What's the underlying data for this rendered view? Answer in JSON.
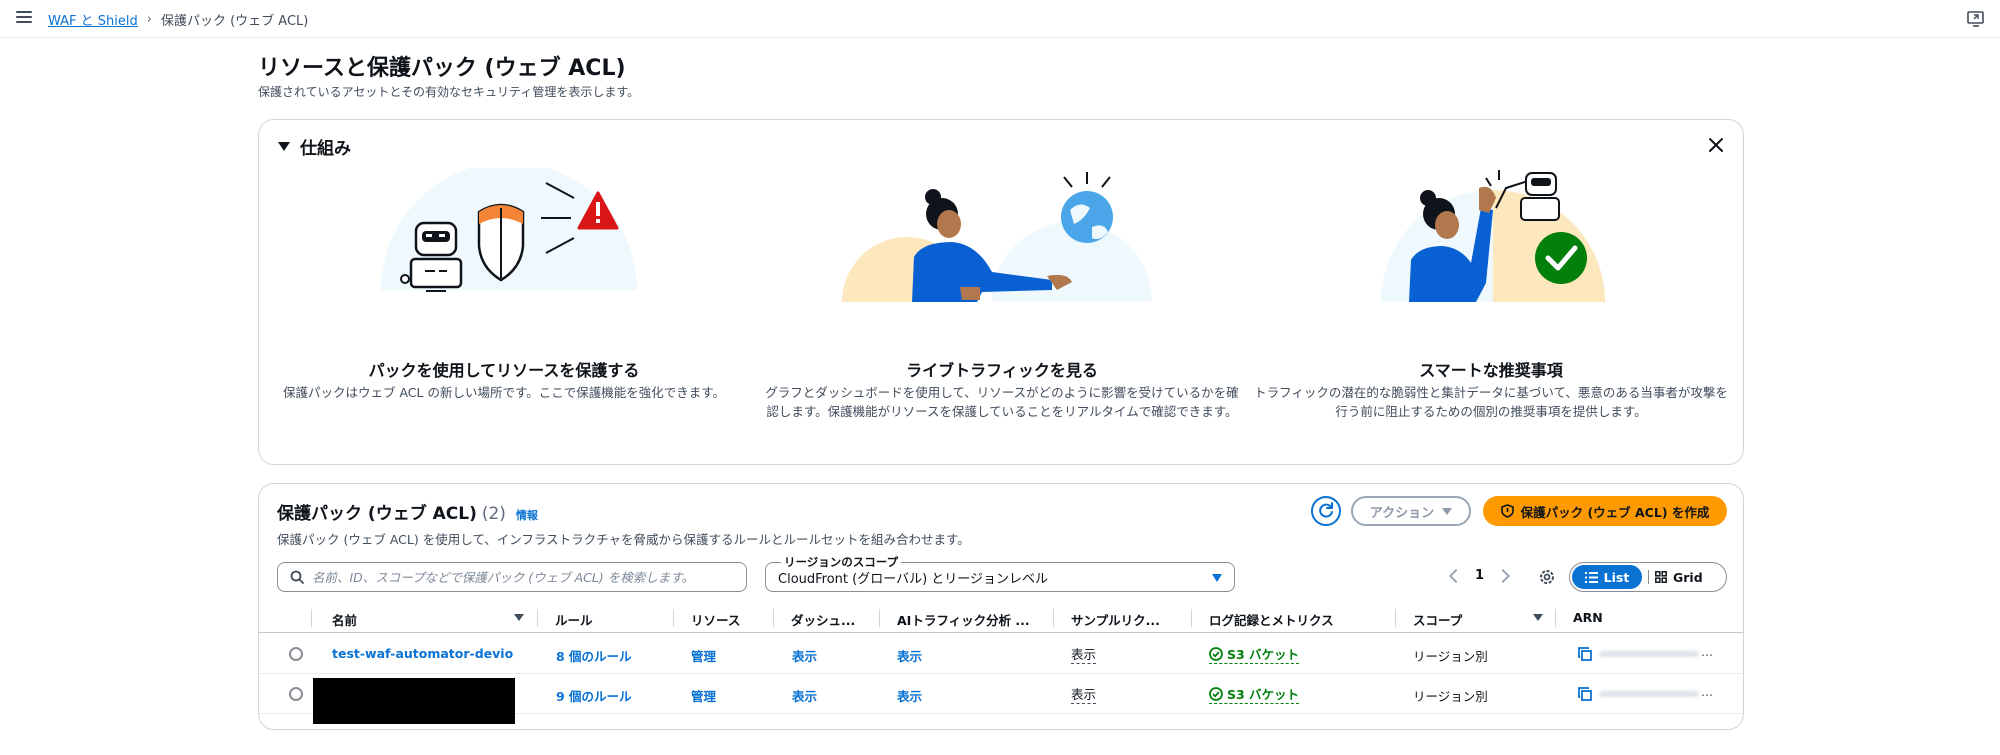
{
  "breadcrumb": {
    "parent": "WAF と Shield",
    "current": "保護パック (ウェブ ACL)"
  },
  "page": {
    "title": "リソースと保護パック (ウェブ ACL)",
    "description": "保護されているアセットとその有効なセキュリティ管理を表示します。"
  },
  "how_it_works": {
    "title": "仕組み",
    "columns": [
      {
        "title": "パックを使用してリソースを保護する",
        "description": "保護パックはウェブ ACL の新しい場所です。ここで保護機能を強化できます。"
      },
      {
        "title": "ライブトラフィックを見る",
        "description": "グラフとダッシュボードを使用して、リソースがどのように影響を受けているかを確認します。保護機能がリソースを保護していることをリアルタイムで確認できます。"
      },
      {
        "title": "スマートな推奨事項",
        "description": "トラフィックの潜在的な脆弱性と集計データに基づいて、悪意のある当事者が攻撃を行う前に阻止するための個別の推奨事項を提供します。"
      }
    ]
  },
  "packs": {
    "title": "保護パック (ウェブ ACL)",
    "count": "(2)",
    "info": "情報",
    "description": "保護パック (ウェブ ACL) を使用して、インフラストラクチャを脅威から保護するルールとルールセットを組み合わせます。",
    "actions_label": "アクション",
    "create_label": "保護パック (ウェブ ACL) を作成",
    "search_placeholder": "名前、ID、スコープなどで保護パック (ウェブ ACL) を検索します。",
    "scope_label": "リージョンのスコープ",
    "scope_value": "CloudFront (グローバル) とリージョンレベル",
    "page_number": "1",
    "view_list": "List",
    "view_grid": "Grid",
    "columns": [
      "名前",
      "ルール",
      "リソース",
      "ダッシュ...",
      "AIトラフィック分析 ...",
      "サンプルリク...",
      "ログ記録とメトリクス",
      "スコープ",
      "ARN"
    ],
    "rows": [
      {
        "name": "test-waf-automator-devio",
        "rules": "8 個のルール",
        "resources": "管理",
        "dashboard": "表示",
        "ai": "表示",
        "sample": "表示",
        "logging": "S3 バケット",
        "scope": "リージョン別",
        "arn_more": "..."
      },
      {
        "name": "",
        "rules": "9 個のルール",
        "resources": "管理",
        "dashboard": "表示",
        "ai": "表示",
        "sample": "表示",
        "logging": "S3 バケット",
        "scope": "リージョン別",
        "arn_more": "..."
      }
    ]
  },
  "colors": {
    "link": "#0972d3",
    "primary_button": "#ff9900",
    "success": "#037f0c",
    "warning_icon": "#d91515"
  }
}
